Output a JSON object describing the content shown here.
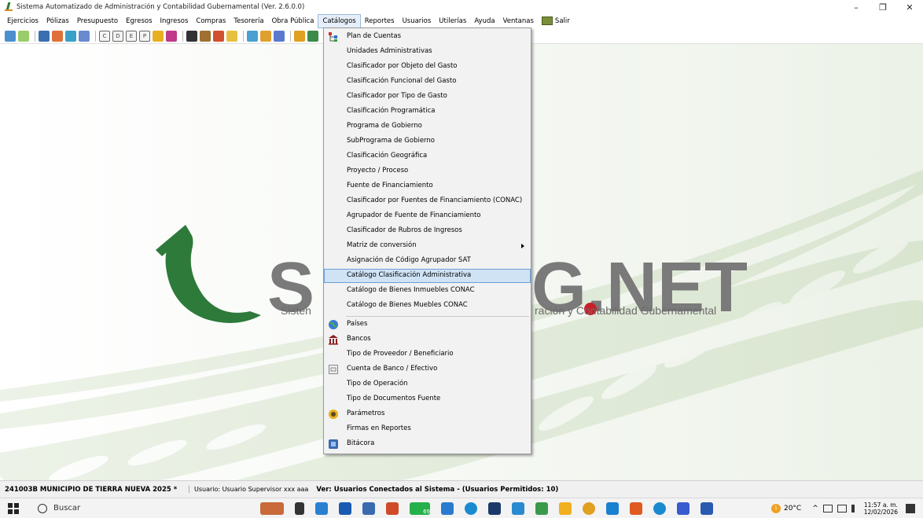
{
  "window": {
    "title": "Sistema Automatizado de Administración y Contabilidad Gubernamental  (Ver. 2.6.0.0)",
    "minimize_glyph": "–",
    "restore_glyph": "❐",
    "close_glyph": "✕"
  },
  "menubar": {
    "items": [
      "Ejercicios",
      "Pólizas",
      "Presupuesto",
      "Egresos",
      "Ingresos",
      "Compras",
      "Tesorería",
      "Obra Pública",
      "Catálogos",
      "Reportes",
      "Usuarios",
      "Utilerías",
      "Ayuda",
      "Ventanas",
      "Salir"
    ],
    "open_item": "Catálogos"
  },
  "toolbar": {
    "letter_buttons": [
      "C",
      "D",
      "E",
      "P"
    ]
  },
  "logo": {
    "wordmark_left": "S",
    "wordmark_right": "G.NET",
    "tagline_left": "Sisten",
    "tagline_right": "ración y Contabilidad Gubernamental"
  },
  "catalogos_menu": {
    "items": [
      {
        "label": "Plan de Cuentas",
        "icon": "tree-icon"
      },
      {
        "label": "Unidades Administrativas"
      },
      {
        "label": "Clasificador por Objeto del Gasto"
      },
      {
        "label": "Clasificación Funcional del Gasto"
      },
      {
        "label": "Clasificador por Tipo de Gasto"
      },
      {
        "label": "Clasificación Programática"
      },
      {
        "label": "Programa de Gobierno"
      },
      {
        "label": "SubPrograma de Gobierno"
      },
      {
        "label": "Clasificación Geográfica"
      },
      {
        "label": "Proyecto / Proceso"
      },
      {
        "label": "Fuente de Financiamiento"
      },
      {
        "label": "Clasificador por Fuentes de Financiamiento (CONAC)"
      },
      {
        "label": "Agrupador de Fuente de Financiamiento"
      },
      {
        "label": "Clasificador de Rubros de Ingresos"
      },
      {
        "label": "Matriz de conversión",
        "submenu": true
      },
      {
        "label": "Asignación de Código Agrupador SAT"
      },
      {
        "label": "Catálogo Clasificación Administrativa",
        "highlighted": true
      },
      {
        "label": "Catálogo de Bienes Inmuebles CONAC"
      },
      {
        "label": "Catálogo de Bienes Muebles CONAC"
      },
      {
        "label": "Países",
        "icon": "globe-icon",
        "separator_before": true
      },
      {
        "label": "Bancos",
        "icon": "bank-icon"
      },
      {
        "label": "Tipo de Proveedor / Beneficiario"
      },
      {
        "label": "Cuenta de Banco / Efectivo",
        "icon": "bank-account-icon"
      },
      {
        "label": "Tipo de Operación"
      },
      {
        "label": "Tipo de Documentos Fuente"
      },
      {
        "label": "Parámetros",
        "icon": "parameters-icon"
      },
      {
        "label": "Firmas en Reportes"
      },
      {
        "label": "Bitácora",
        "icon": "log-icon"
      }
    ]
  },
  "statusbar": {
    "entity": "241003B MUNICIPIO DE TIERRA NUEVA  2025  *",
    "user": "Usuario: Usuario Supervisor xxx aaa",
    "connected": "Ver: Usuarios Conectados al Sistema - (Usuarios Permitidos: 10)"
  },
  "taskbar": {
    "search_placeholder": "Buscar",
    "notification_count": "69",
    "temperature": "20°C",
    "time": "11:57 a. m.",
    "date": "12/02/2026",
    "weather_badge": "1"
  },
  "colors": {
    "menu_highlight": "#cfe3f5",
    "logo_green": "#2d7a3a",
    "logo_red": "#c8202a",
    "logo_gray": "#7a7a7a"
  }
}
